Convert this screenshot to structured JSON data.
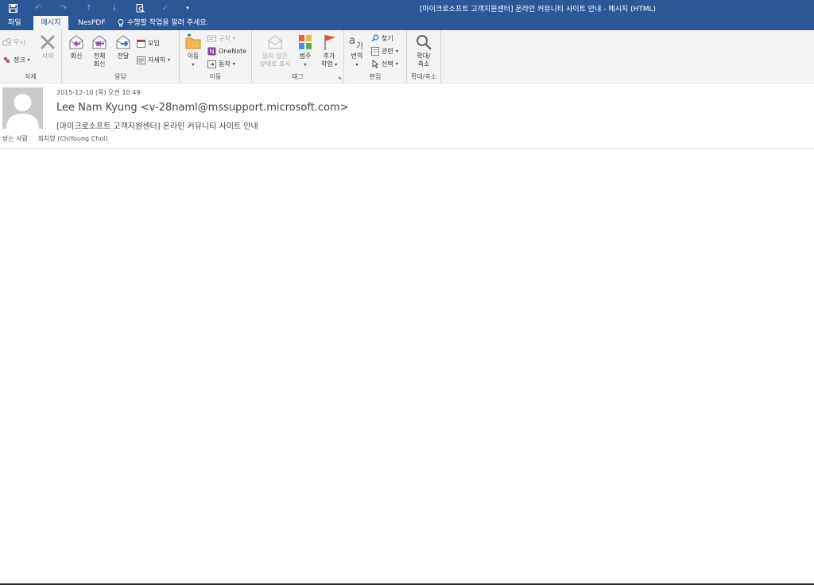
{
  "window": {
    "title": "[마이크로소프트 고객지원센터] 온라인 커뮤니티 사이트 안내  - 메시지 (HTML)"
  },
  "qat": {
    "save_icon": "floppy-disk-icon",
    "undo_icon": "undo-icon",
    "redo_icon": "redo-icon",
    "up_icon": "arrow-up-icon",
    "down_icon": "arrow-down-icon",
    "preview_icon": "print-preview-icon",
    "check_icon": "check-icon",
    "more_icon": "dropdown-arrow-icon"
  },
  "tabs": [
    {
      "label": "파일",
      "active": false
    },
    {
      "label": "메시지",
      "active": true
    },
    {
      "label": "NesPDF",
      "active": false
    }
  ],
  "tell_me": "수행할 작업을 알려 주세요.",
  "ribbon": {
    "delete_group": {
      "label": "삭제",
      "ignore": "무시",
      "cleanup": "정크",
      "delete": "삭제"
    },
    "respond_group": {
      "label": "응답",
      "reply": "회신",
      "reply_all_line1": "전체",
      "reply_all_line2": "회신",
      "forward": "전달",
      "meeting": "모임",
      "more": "자세히"
    },
    "move_group": {
      "label": "이동",
      "move": "이동",
      "rules": "규칙",
      "onenote": "OneNote",
      "actions": "동작"
    },
    "tags_group": {
      "label": "태그",
      "mark_unread_line1": "읽지 않은",
      "mark_unread_line2": "상태로 표시",
      "categorize": "범주",
      "follow_up_line1": "추가",
      "follow_up_line2": "작업"
    },
    "editing_group": {
      "label": "편집",
      "translate": "번역",
      "find": "찾기",
      "related": "관련",
      "select": "선택"
    },
    "zoom_group": {
      "label": "확대/축소",
      "zoom_line1": "확대/",
      "zoom_line2": "축소"
    }
  },
  "message": {
    "date": "2015-12-10 (목) 오전 10:49",
    "from": "Lee Nam Kyung <v-28naml@mssupport.microsoft.com>",
    "subject": "[마이크로소프트 고객지원센터] 온라인 커뮤니티 사이트 안내",
    "to_label": "받는 사람",
    "to": "최치영 (ChiYoung Choi)"
  },
  "colors": {
    "titlebar": "#2b5797",
    "ribbon": "#f4f4f4",
    "flag": "#e0523a"
  }
}
